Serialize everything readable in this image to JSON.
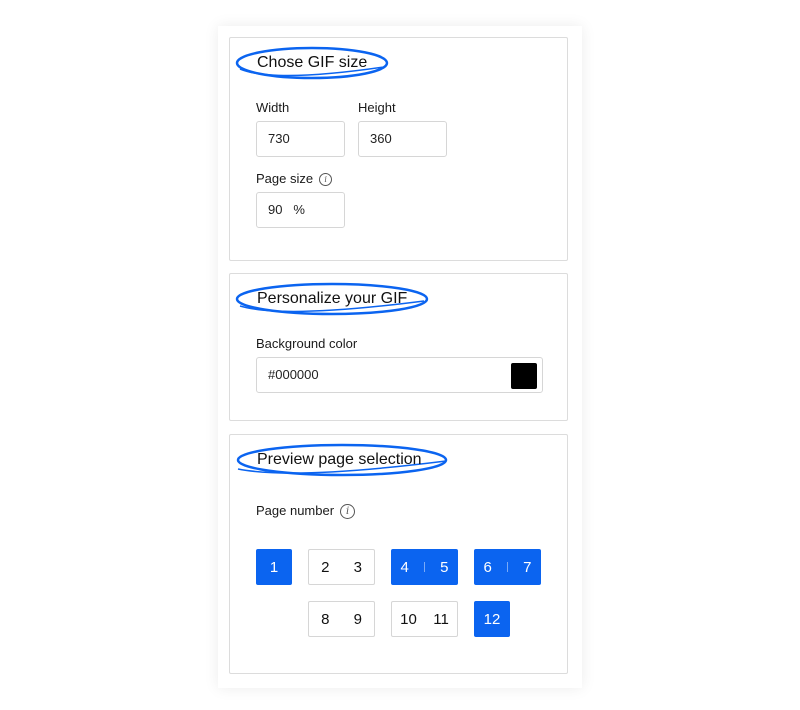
{
  "accent_color": "#0b64f0",
  "gif_size": {
    "title": "Chose GIF size",
    "width_label": "Width",
    "width_value": "730",
    "height_label": "Height",
    "height_value": "360",
    "page_size_label": "Page size",
    "page_size_value": "90",
    "page_size_unit": "%",
    "info_icon": "info-icon"
  },
  "personalize": {
    "title": "Personalize your GIF",
    "bg_color_label": "Background color",
    "bg_color_value": "#000000",
    "swatch_color": "#000000"
  },
  "preview": {
    "title": "Preview page selection",
    "page_number_label": "Page number",
    "info_icon": "info-icon",
    "page_groups": [
      {
        "pages": [
          "1"
        ],
        "selected": true
      },
      {
        "pages": [
          "2",
          "3"
        ],
        "selected": false
      },
      {
        "pages": [
          "4",
          "5"
        ],
        "selected": true
      },
      {
        "pages": [
          "6",
          "7"
        ],
        "selected": true
      },
      {
        "pages": [
          "8",
          "9"
        ],
        "selected": false
      },
      {
        "pages": [
          "10",
          "11"
        ],
        "selected": false
      },
      {
        "pages": [
          "12"
        ],
        "selected": true
      }
    ]
  }
}
